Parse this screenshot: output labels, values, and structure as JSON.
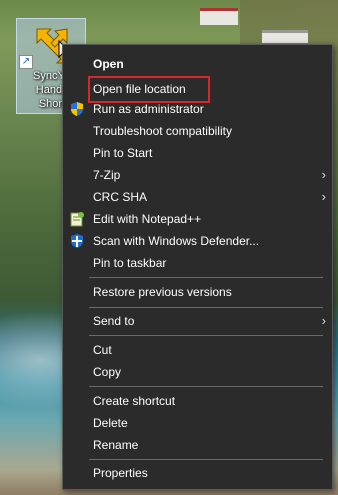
{
  "desktop": {
    "shortcut": {
      "label_lines": [
        "SyncYd",
        "Handh",
        "Short"
      ]
    }
  },
  "menu": {
    "items": [
      {
        "label": "Open",
        "bold": true
      },
      {
        "label": "Open file location",
        "highlighted": true
      },
      {
        "label": "Run as administrator",
        "icon": "uac-shield-icon"
      },
      {
        "label": "Troubleshoot compatibility"
      },
      {
        "label": "Pin to Start"
      },
      {
        "label": "7-Zip",
        "submenu": true
      },
      {
        "label": "CRC SHA",
        "submenu": true
      },
      {
        "label": "Edit with Notepad++",
        "icon": "notepad-plus-plus-icon"
      },
      {
        "label": "Scan with Windows Defender...",
        "icon": "windows-defender-icon"
      },
      {
        "label": "Pin to taskbar"
      },
      {
        "label": "Restore previous versions"
      },
      {
        "label": "Send to",
        "submenu": true
      },
      {
        "label": "Cut"
      },
      {
        "label": "Copy"
      },
      {
        "label": "Create shortcut"
      },
      {
        "label": "Delete"
      },
      {
        "label": "Rename"
      },
      {
        "label": "Properties"
      }
    ],
    "submenu_glyph": "›"
  },
  "colors": {
    "menu_bg": "#2b2b2b",
    "highlight_border": "#d9262b",
    "shortcut_icon": "#f5b400"
  }
}
